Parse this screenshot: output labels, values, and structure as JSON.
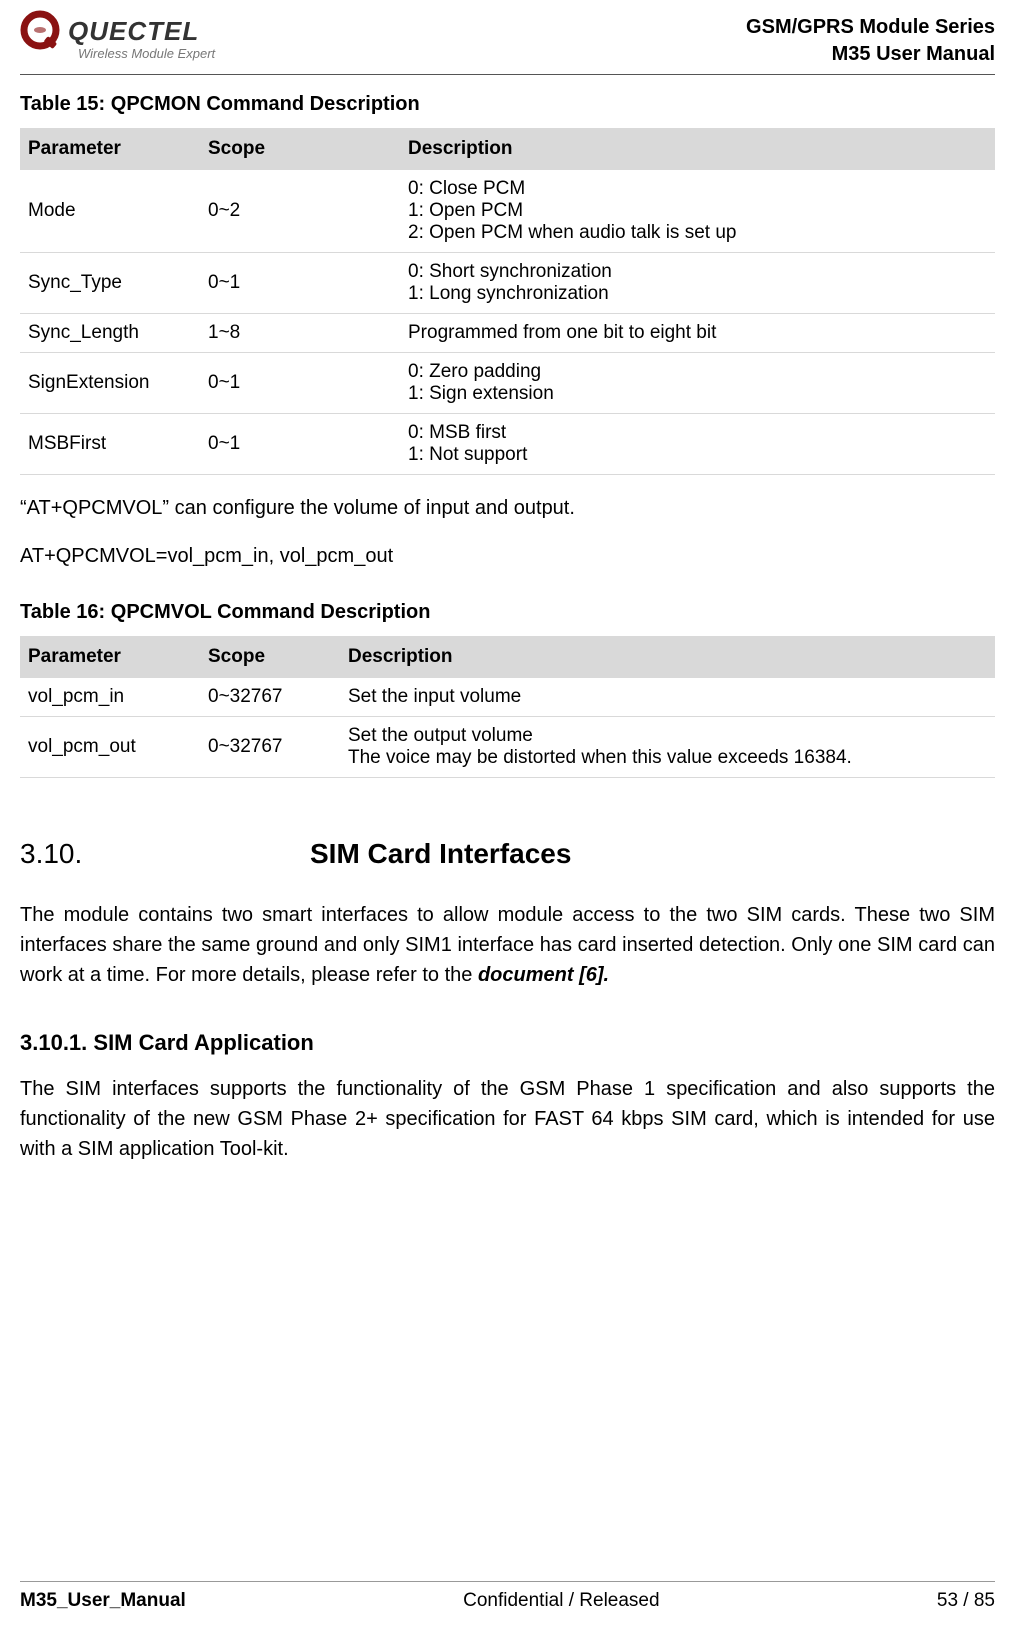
{
  "header": {
    "logo_text": "QUECTEL",
    "logo_sub": "Wireless Module Expert",
    "line1": "GSM/GPRS  Module  Series",
    "line2": "M35  User  Manual"
  },
  "table15": {
    "caption": "Table 15: QPCMON Command Description",
    "head_param": "Parameter",
    "head_scope": "Scope",
    "head_desc": "Description",
    "rows": [
      {
        "param": "Mode",
        "scope": "0~2",
        "desc": "0: Close PCM\n1: Open PCM\n2: Open PCM when audio talk is set up"
      },
      {
        "param": "Sync_Type",
        "scope": "0~1",
        "desc": "0: Short synchronization\n1: Long synchronization"
      },
      {
        "param": "Sync_Length",
        "scope": "1~8",
        "desc": "Programmed from one bit to eight bit"
      },
      {
        "param": "SignExtension",
        "scope": "0~1",
        "desc": "0: Zero padding\n1: Sign extension"
      },
      {
        "param": "MSBFirst",
        "scope": "0~1",
        "desc": "0: MSB first\n1: Not support"
      }
    ]
  },
  "para1": "“AT+QPCMVOL” can configure the volume of input and output.",
  "para2": "AT+QPCMVOL=vol_pcm_in, vol_pcm_out",
  "table16": {
    "caption": "Table 16: QPCMVOL Command Description",
    "head_param": "Parameter",
    "head_scope": "Scope",
    "head_desc": "Description",
    "rows": [
      {
        "param": "vol_pcm_in",
        "scope": "0~32767",
        "desc": "Set the input volume"
      },
      {
        "param": "vol_pcm_out",
        "scope": "0~32767",
        "desc": "Set the output volume\nThe voice may be distorted when this value exceeds 16384."
      }
    ]
  },
  "section": {
    "num": "3.10.",
    "title": "SIM Card Interfaces",
    "body_pre": "The module contains two smart interfaces to allow module access to the two SIM cards. These two SIM interfaces share the same ground and only SIM1 interface has card inserted detection. Only one SIM card can work at a time. For more details, please refer to the ",
    "docref": "document [6].",
    "sub_num_title": "3.10.1.  SIM Card Application",
    "sub_body": "The SIM interfaces supports the functionality of the GSM Phase 1 specification and also supports the functionality of the new GSM Phase 2+ specification for FAST 64 kbps SIM card, which is intended for use with a SIM application Tool-kit."
  },
  "footer": {
    "left": "M35_User_Manual",
    "center": "Confidential / Released",
    "right": "53 / 85"
  }
}
